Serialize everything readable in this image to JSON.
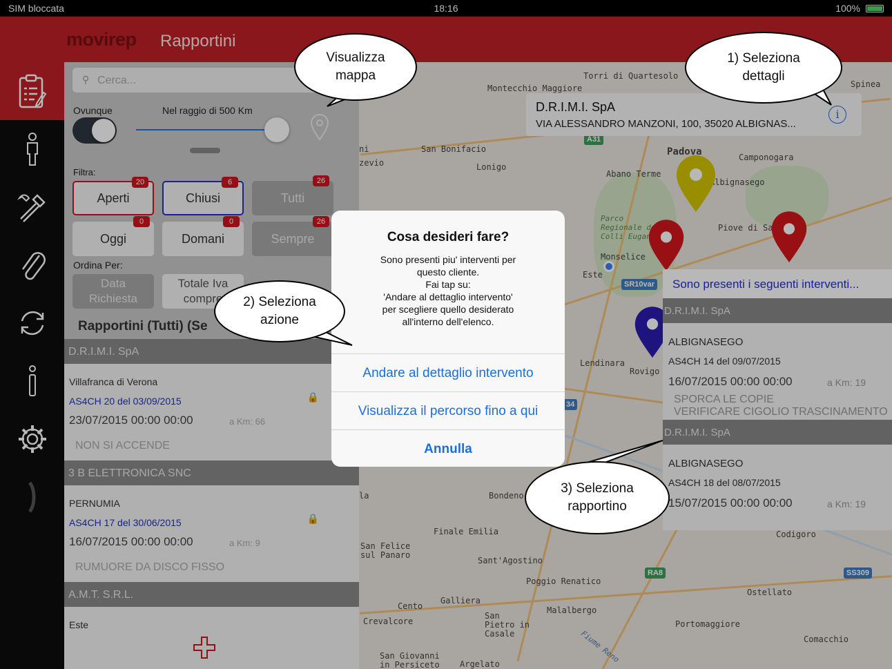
{
  "status_bar": {
    "carrier": "SIM bloccata",
    "time": "18:16",
    "battery": "100%"
  },
  "header": {
    "brand": "movirep",
    "section": "Rapportini"
  },
  "nav": {
    "icons": [
      "clipboard-icon",
      "person-icon",
      "tools-icon",
      "paperclip-icon",
      "sync-icon",
      "info-icon",
      "gear-icon",
      "chevron-right-icon"
    ]
  },
  "search": {
    "placeholder": "Cerca..."
  },
  "location": {
    "anywhere_label": "Ovunque",
    "radius_label": "Nel raggio di 500 Km",
    "radius_fraction": 1.0
  },
  "filter": {
    "label": "Filtra:",
    "status": [
      {
        "label": "Aperti",
        "count": "20"
      },
      {
        "label": "Chiusi",
        "count": "6"
      },
      {
        "label": "Tutti",
        "count": "26"
      }
    ],
    "time": [
      {
        "label": "Oggi",
        "count": "0"
      },
      {
        "label": "Domani",
        "count": "0"
      },
      {
        "label": "Sempre",
        "count": "26"
      }
    ]
  },
  "sort": {
    "label": "Ordina Per:",
    "option1": "Data\nRichiesta",
    "option2": "Totale Iva\ncompre"
  },
  "list": {
    "title": "Rapportini (Tutti) (Se",
    "groups": [
      {
        "client": "D.R.I.M.I. SpA",
        "city": "Villafranca di Verona",
        "ref": "AS4CH 20 del 03/09/2015",
        "datetime": "23/07/2015  00:00  00:00",
        "km": "a Km: 66",
        "desc": "NON SI ACCENDE"
      },
      {
        "client": "3 B ELETTRONICA SNC",
        "city": "PERNUMIA",
        "ref": "AS4CH 17 del 30/06/2015",
        "datetime": "16/07/2015  00:00  00:00",
        "km": "a Km: 9",
        "desc": "RUMUORE DA DISCO FISSO"
      },
      {
        "client": "A.M.T. S.R.L.",
        "city": "Este"
      }
    ]
  },
  "map": {
    "labels": [
      "Torri di Quartesolo",
      "Montecchio Maggiore",
      "Spinea",
      "San Bonifacio",
      "Lonigo",
      "Padova",
      "Abano Terme",
      "Camponogara",
      "Albignasego",
      "Parco Regionale dei Colli Euganei",
      "Piove di Sacco",
      "Monselice",
      "Este",
      "Lendinara",
      "Rovigo",
      "Bondeno",
      "Finale Emilia",
      "San Felice sul Panaro",
      "Sant'Agostino",
      "Poggio Renatico",
      "Codigoro",
      "Ostellato",
      "Cento",
      "Galliera",
      "San Pietro in Casale",
      "Malalbergo",
      "Crevalcore",
      "Portomaggiore",
      "Comacchio",
      "San Giovanni in Persiceto",
      "Argelato",
      "Fiume Reno",
      "zevio",
      "ni",
      "la"
    ],
    "shields": [
      "A31",
      "SR10var",
      "RA8",
      "SS309",
      "34"
    ],
    "pin_colors": [
      "#d4c400",
      "#d3161c",
      "#d3161c",
      "#2b1bb0"
    ]
  },
  "info_card": {
    "name": "D.R.I.M.I. SpA",
    "address": "VIA ALESSANDRO MANZONI, 100, 35020 ALBIGNAS..."
  },
  "right_list": {
    "title": "Sono presenti i seguenti interventi...",
    "items": [
      {
        "client": "D.R.I.M.I. SpA",
        "city": "ALBIGNASEGO",
        "ref": "AS4CH 14 del 09/07/2015",
        "datetime": "16/07/2015  00:00  00:00",
        "km": "a Km: 19",
        "desc1": "SPORCA LE COPIE",
        "desc2": "VERIFICARE CIGOLIO TRASCINAMENTO"
      },
      {
        "client": "D.R.I.M.I. SpA",
        "city": "ALBIGNASEGO",
        "ref": "AS4CH 18 del 08/07/2015",
        "datetime": "15/07/2015  00:00  00:00",
        "km": "a Km: 19"
      }
    ]
  },
  "dialog": {
    "title": "Cosa desideri fare?",
    "message": "Sono presenti piu' interventi per\nquesto cliente.\nFai tap su:\n'Andare al dettaglio intervento'\nper scegliere quello desiderato\nall'interno dell'elenco.",
    "btn_detail": "Andare al dettaglio intervento",
    "btn_route": "Visualizza il percorso fino a qui",
    "btn_cancel": "Annulla"
  },
  "callouts": {
    "map": "Visualizza\nmappa",
    "details": "1) Seleziona\ndettagli",
    "action": "2) Seleziona\nazione",
    "report": "3) Seleziona\nrapportino"
  },
  "colors": {
    "brand_red": "#bf2026",
    "badge_red": "#d0161f",
    "ios_blue": "#1a6fdc",
    "link_blue": "#2430c4"
  }
}
